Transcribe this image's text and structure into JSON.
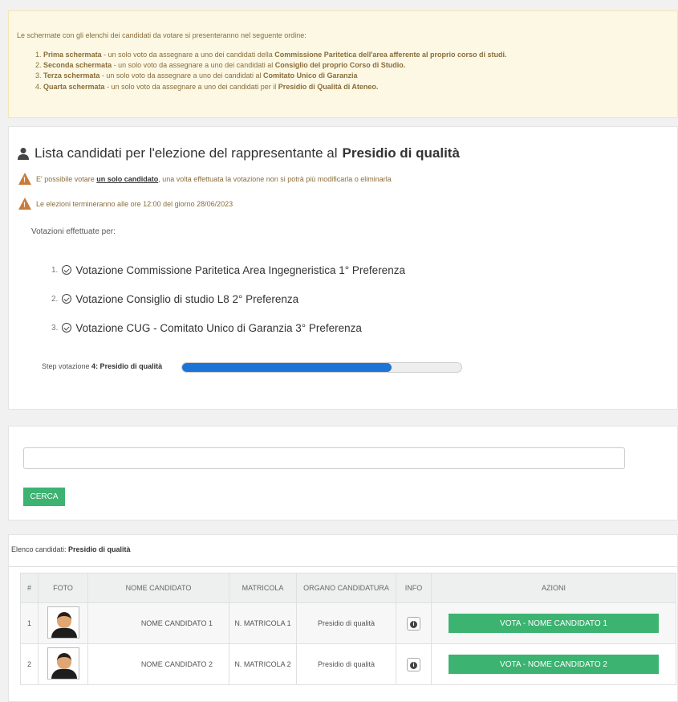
{
  "notice": {
    "intro": "Le schermate con gli elenchi dei candidati da votare si presenteranno nel seguente ordine:",
    "items": [
      {
        "num": "1.",
        "bold1": "Prima schermata",
        "text": " - un solo voto da assegnare a uno dei candidati della ",
        "bold2": "Commissione Paritetica dell'area afferente al proprio corso di studi."
      },
      {
        "num": "2.",
        "bold1": "Seconda schermata",
        "text": " - un solo voto da assegnare a uno dei candidati al ",
        "bold2": "Consiglio del proprio Corso di Studio."
      },
      {
        "num": "3.",
        "bold1": "Terza schermata",
        "text": " - un solo voto da assegnare a uno dei candidati al ",
        "bold2": "Comitato Unico di Garanzia"
      },
      {
        "num": "4.",
        "bold1": "Quarta schermata",
        "text": " - un solo voto da assegnare a uno dei candidati per il ",
        "bold2": "Presidio di Qualità di Ateneo."
      }
    ]
  },
  "header": {
    "title": "Lista candidati per l'elezione del rappresentante al ",
    "title_bold": "Presidio di qualità",
    "warn1_pre": "E' possibile votare ",
    "warn1_link": "un solo candidato",
    "warn1_post": ", una volta effettuata la votazione non si potrà più modificarla o eliminarla",
    "warn2": "Le elezioni termineranno alle ore 12:00 del giorno 28/06/2023",
    "done_label": "Votazioni effettuate per:"
  },
  "votes_done": [
    {
      "num": "1.",
      "text": "Votazione Commissione Paritetica Area Ingegneristica 1° Preferenza"
    },
    {
      "num": "2.",
      "text": "Votazione Consiglio di studio L8 2° Preferenza"
    },
    {
      "num": "3.",
      "text": "Votazione CUG - Comitato Unico di Garanzia 3° Preferenza"
    }
  ],
  "step": {
    "label": "Step votazione ",
    "num": "4",
    "name": ": Presidio di qualità",
    "progress": 0.75
  },
  "search": {
    "value": "",
    "button": "CERCA"
  },
  "list": {
    "label": "Elenco candidati: ",
    "label_bold": "Presidio di qualità",
    "headers": [
      "#",
      "FOTO",
      "NOME CANDIDATO",
      "MATRICOLA",
      "ORGANO CANDIDATURA",
      "INFO",
      "AZIONI"
    ],
    "rows": [
      {
        "n": "1",
        "name": "NOME CANDIDATO 1",
        "matricola": "N. MATRICOLA 1",
        "organo": "Presidio di qualità",
        "action": "VOTA - NOME CANDIDATO 1"
      },
      {
        "n": "2",
        "name": "NOME CANDIDATO 2",
        "matricola": "N. MATRICOLA 2",
        "organo": "Presidio di qualità",
        "action": "VOTA - NOME CANDIDATO 2"
      }
    ]
  },
  "colors": {
    "primary": "#1c75d6",
    "success": "#3cb371",
    "warning_bg": "#fcf8e3",
    "warning_text": "#8a6d3b"
  },
  "icons": {
    "title": "user-icon",
    "warning": "warning-triangle-icon",
    "check": "check-circle-icon",
    "info": "info-icon",
    "avatar": "candidate-avatar"
  }
}
